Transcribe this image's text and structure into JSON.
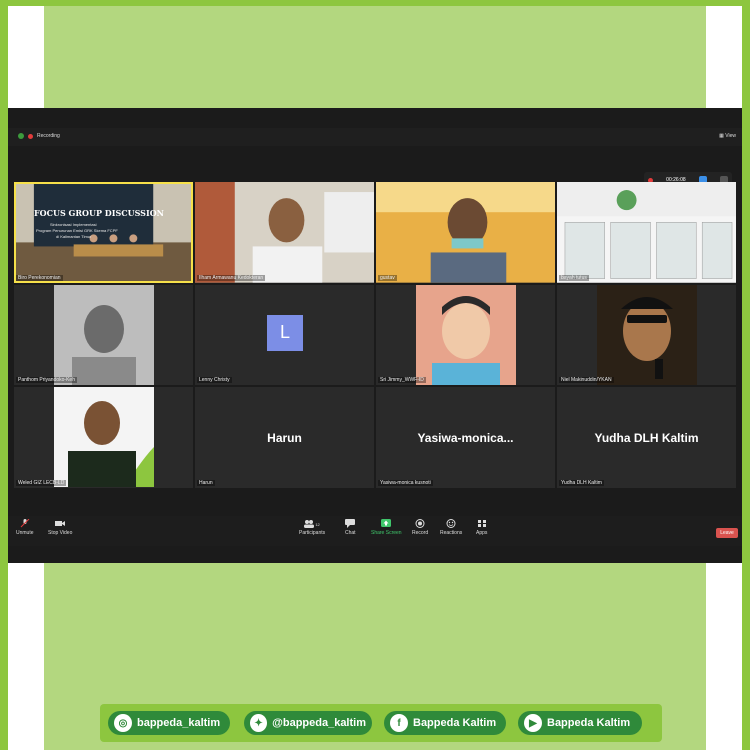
{
  "window": {
    "recording": "Recording",
    "view": "View",
    "timer": "00:26:08"
  },
  "tiles": [
    {
      "name": "Biro Perekonomian",
      "active": true
    },
    {
      "name": "Ilham Armawanu Kedokteran",
      "active": false
    },
    {
      "name": "gustav",
      "active": false
    },
    {
      "name": "bayah tutus",
      "active": false
    },
    {
      "name": "Panthom Priyandoko-Keh",
      "active": false
    },
    {
      "name": "Lenny Christy",
      "active": false,
      "avatar_letter": "L"
    },
    {
      "name": "Sri Jimmy_WWF-ID",
      "active": false
    },
    {
      "name": "Niel Makinuddin/YKAN",
      "active": false
    },
    {
      "name": "Weled GIZ LECB-LD",
      "active": false
    },
    {
      "name": "Harun",
      "active": false,
      "big": "Harun"
    },
    {
      "name": "Yasiwa-monica kusnoti",
      "active": false,
      "big": "Yasiwa-monica..."
    },
    {
      "name": "Yudha DLH Kaltim",
      "active": false,
      "big": "Yudha DLH Kaltim"
    }
  ],
  "slide": {
    "title": "FOCUS GROUP DISCUSSION",
    "line1": "Sinkronisasi Implementasi",
    "line2": "Program Penurunan Emisi GRK Skema FCPF",
    "line3": "di Kalimantan Timur"
  },
  "toolbar": {
    "unmute": "Unmute",
    "stop_video": "Stop Video",
    "participants": "Participants",
    "participants_count": "12",
    "chat": "Chat",
    "share_screen": "Share Screen",
    "record": "Record",
    "reactions": "Reactions",
    "apps": "Apps",
    "leave": "Leave"
  },
  "social": [
    {
      "icon": "instagram-icon",
      "glyph": "◎",
      "label": "bappeda_kaltim"
    },
    {
      "icon": "twitter-icon",
      "glyph": "✦",
      "label": "@bappeda_kaltim"
    },
    {
      "icon": "facebook-icon",
      "glyph": "f",
      "label": "Bappeda Kaltim"
    },
    {
      "icon": "youtube-icon",
      "glyph": "▶",
      "label": "Bappeda Kaltim"
    }
  ],
  "colors": {
    "frame": "#8dc63f",
    "panel": "#b3d77f",
    "pill": "#2f8a3a",
    "leave": "#d9534f",
    "active_speaker": "#f6e04a"
  }
}
